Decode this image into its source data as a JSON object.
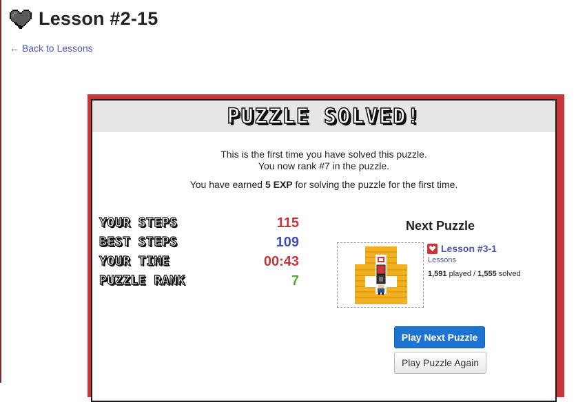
{
  "header": {
    "title": "Lesson #2-15",
    "icon": "heart-icon"
  },
  "nav": {
    "back_label": "← Back to Lessons"
  },
  "modal": {
    "banner": "PUZZLE SOLVED!",
    "message_line1": "This is the first time you have solved this puzzle.",
    "message_line2": "You now rank #7 in the puzzle.",
    "exp_prefix": "You have earned ",
    "exp_value": "5 EXP",
    "exp_suffix": " for solving the puzzle for the first time.",
    "stats": [
      {
        "label": "YOUR STEPS",
        "value": "115",
        "color": "#c0393d"
      },
      {
        "label": "BEST STEPS",
        "value": "109",
        "color": "#3f4fb8"
      },
      {
        "label": "YOUR TIME",
        "value": "00:43",
        "color": "#c0393d"
      },
      {
        "label": "PUZZLE RANK",
        "value": "7",
        "color": "#5aaa3a"
      }
    ],
    "next": {
      "title": "Next Puzzle",
      "name": "Lesson #3-1",
      "category": "Lessons",
      "played": "1,591",
      "played_label": " played / ",
      "solved": "1,555",
      "solved_label": " solved"
    },
    "buttons": {
      "play_next": "Play Next Puzzle",
      "play_again": "Play Puzzle Again"
    }
  },
  "colors": {
    "accent": "#c8363a",
    "link": "#4a57b8",
    "primary_button": "#1e75d1"
  }
}
